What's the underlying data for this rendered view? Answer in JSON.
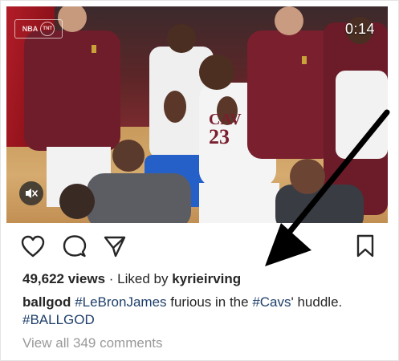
{
  "video": {
    "timestamp": "0:14",
    "badge_left": "NBA",
    "badge_right": "TNT",
    "jersey_text": "CAV",
    "jersey_number": "23",
    "mute_icon": "speaker-muted-icon"
  },
  "actions": {
    "like_icon": "heart-icon",
    "comment_icon": "comment-bubble-icon",
    "share_icon": "paper-plane-icon",
    "save_icon": "bookmark-icon"
  },
  "post": {
    "views": "49,622 views",
    "liked_by_prefix": " · Liked by ",
    "liked_by_user": "kyrieirving",
    "author": "ballgod",
    "caption_tag1": "#LeBronJames",
    "caption_mid": " furious in the ",
    "caption_tag2": "#Cavs",
    "caption_end": "' huddle.",
    "caption_tag3": "#BALLGOD",
    "view_all_comments": "View all 349 comments"
  },
  "colors": {
    "text": "#262626",
    "hashtag": "#1e3f6b",
    "muted": "#999999",
    "wine_jersey": "#6f1d2a"
  }
}
